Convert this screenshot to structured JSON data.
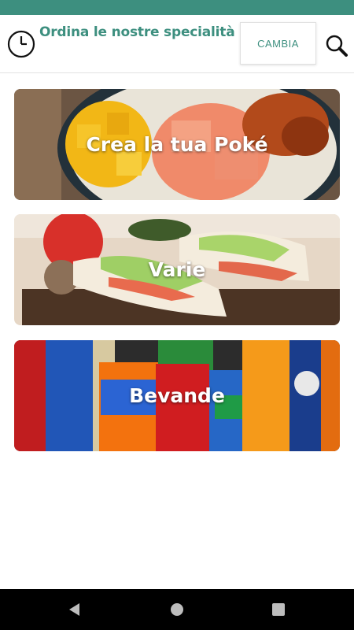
{
  "header": {
    "title": "Ordina le nostre specialità",
    "change_label": "CAMBIA",
    "clock_icon": "clock-icon",
    "search_icon": "search-icon"
  },
  "categories": [
    {
      "label": "Crea la tua Poké"
    },
    {
      "label": "Varie"
    },
    {
      "label": "Bevande"
    }
  ],
  "colors": {
    "accent": "#3d8f7f",
    "nav_bar": "#000000"
  },
  "nav": {
    "back_icon": "back-icon",
    "home_icon": "home-icon",
    "recents_icon": "recents-icon"
  }
}
